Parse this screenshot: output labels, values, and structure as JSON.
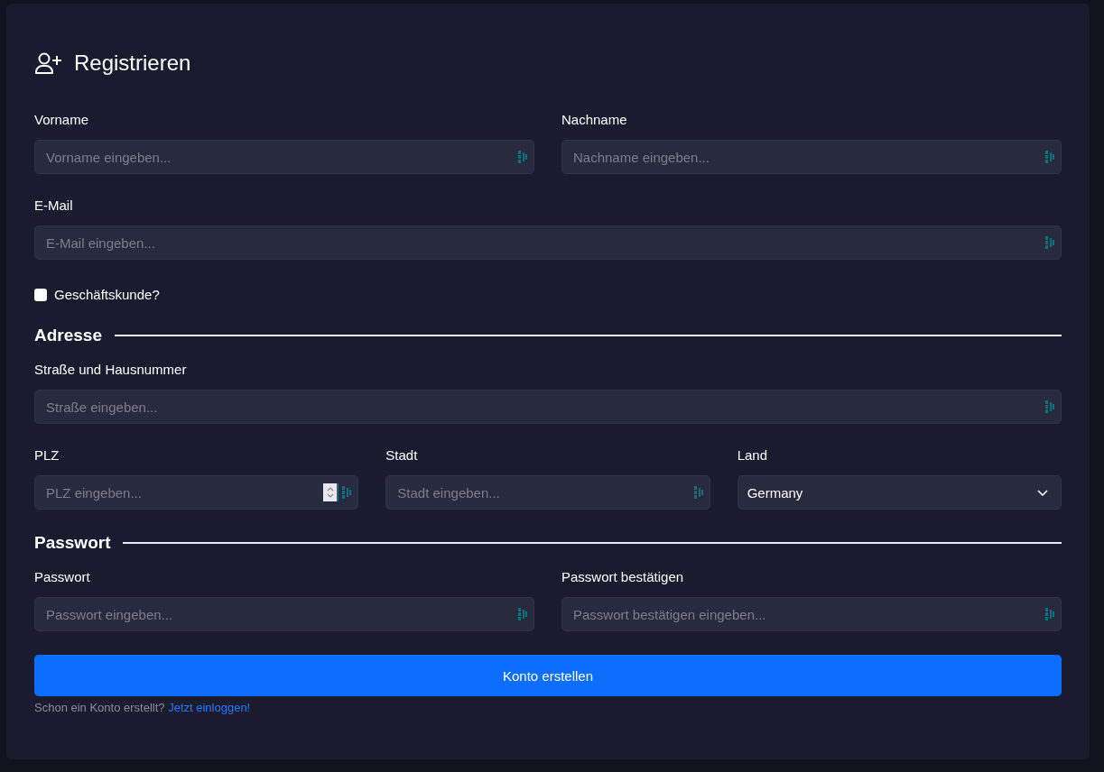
{
  "title": "Registrieren",
  "sections": [
    {
      "rows": [
        [
          {
            "kind": "text",
            "label": "Vorname",
            "placeholder": "Vorname eingeben..."
          },
          {
            "kind": "text",
            "label": "Nachname",
            "placeholder": "Nachname eingeben..."
          }
        ],
        [
          {
            "kind": "text",
            "label": "E-Mail",
            "placeholder": "E-Mail eingeben..."
          }
        ],
        [
          {
            "kind": "checkbox",
            "label": "Geschäftskunde?",
            "checked": false
          }
        ]
      ]
    },
    {
      "heading": "Adresse",
      "rows": [
        [
          {
            "kind": "text",
            "label": "Straße und Hausnummer",
            "placeholder": "Straße eingeben..."
          }
        ],
        [
          {
            "kind": "number",
            "label": "PLZ",
            "placeholder": "PLZ eingeben..."
          },
          {
            "kind": "text",
            "label": "Stadt",
            "placeholder": "Stadt eingeben..."
          },
          {
            "kind": "select",
            "label": "Land",
            "value": "Germany"
          }
        ]
      ]
    },
    {
      "heading": "Passwort",
      "rows": [
        [
          {
            "kind": "text",
            "label": "Passwort",
            "placeholder": "Passwort eingeben..."
          },
          {
            "kind": "text",
            "label": "Passwort bestätigen",
            "placeholder": "Passwort bestätigen eingeben..."
          }
        ]
      ]
    }
  ],
  "submit": "Konto erstellen",
  "footer": {
    "text": "Schon ein Konto erstellt?",
    "link": "Jetzt einloggen!"
  }
}
